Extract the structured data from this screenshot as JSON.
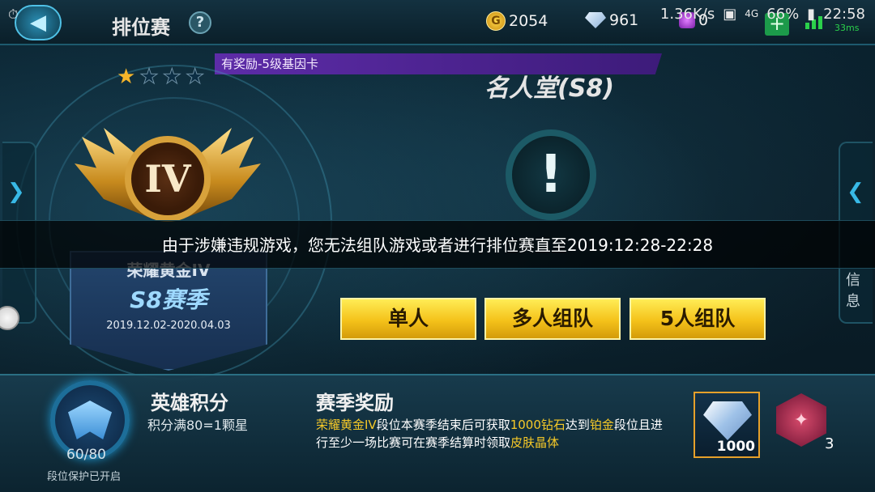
{
  "status_bar": {
    "speed": "1.36K/s",
    "network": "4G",
    "battery": "66%",
    "time": "22:58"
  },
  "header": {
    "title": "排位赛",
    "help_label": "?",
    "back_icon": "back-arrow-icon",
    "gold": "2054",
    "diamonds": "961",
    "gems": "0",
    "add_label": "+",
    "ping": "33ms"
  },
  "reward_banner": "有奖励-5级基因卡",
  "rank": {
    "stars_filled": 1,
    "stars_total": 4,
    "tier_numeral": "IV",
    "tier_name": "荣耀黄金IV",
    "season": "S8赛季",
    "season_dates": "2019.12.02-2020.04.03"
  },
  "hall_of_fame": {
    "title": "名人堂(S8)",
    "emblem": "!"
  },
  "ban_notice": "由于涉嫌违规游戏，您无法组队游戏或者进行排位赛直至2019:12:28-22:28",
  "modes": [
    {
      "label": "单人"
    },
    {
      "label": "多人组队"
    },
    {
      "label": "5人组队"
    }
  ],
  "right_tab": {
    "label": "信息"
  },
  "hero_points": {
    "title": "英雄积分",
    "subtitle": "积分满80=1颗星",
    "progress": "60/80",
    "protection": "段位保护已开启"
  },
  "season_reward": {
    "title": "赛季奖励",
    "desc_parts": [
      {
        "text": "荣耀黄金IV",
        "hl": true
      },
      {
        "text": "段位本赛季结束后可获取",
        "hl": false
      },
      {
        "text": "1000钻石",
        "hl": true
      },
      {
        "text": "达到",
        "hl": false
      },
      {
        "text": "铂金",
        "hl": true
      },
      {
        "text": "段位且进行至少一场比赛可在赛季结算时领取",
        "hl": false
      },
      {
        "text": "皮肤晶体",
        "hl": true
      }
    ],
    "items": [
      {
        "icon": "diamond-icon",
        "qty": "1000"
      },
      {
        "icon": "skin-crystal-icon",
        "qty": "3"
      }
    ]
  },
  "colors": {
    "accent_gold": "#f6c928",
    "banner_purple": "#5d2ca8",
    "cyan": "#38b9e6"
  }
}
